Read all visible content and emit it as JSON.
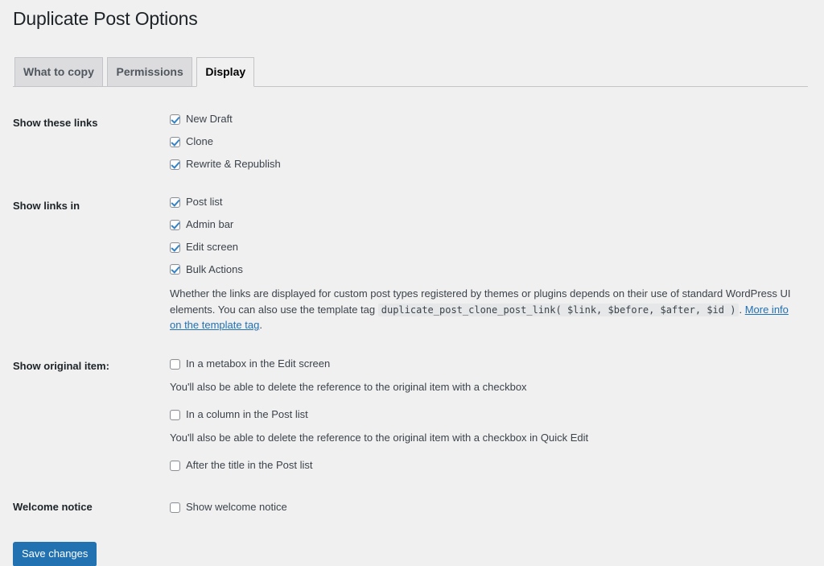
{
  "page": {
    "title": "Duplicate Post Options"
  },
  "tabs": [
    {
      "label": "What to copy",
      "active": false
    },
    {
      "label": "Permissions",
      "active": false
    },
    {
      "label": "Display",
      "active": true
    }
  ],
  "sections": {
    "show_these_links": {
      "heading": "Show these links",
      "options": [
        {
          "label": "New Draft",
          "checked": true
        },
        {
          "label": "Clone",
          "checked": true
        },
        {
          "label": "Rewrite & Republish",
          "checked": true
        }
      ]
    },
    "show_links_in": {
      "heading": "Show links in",
      "options": [
        {
          "label": "Post list",
          "checked": true
        },
        {
          "label": "Admin bar",
          "checked": true
        },
        {
          "label": "Edit screen",
          "checked": true
        },
        {
          "label": "Bulk Actions",
          "checked": true
        }
      ],
      "description_part1": "Whether the links are displayed for custom post types registered by themes or plugins depends on their use of standard WordPress UI elements. You can also use the template tag",
      "description_code": "duplicate_post_clone_post_link( $link, $before, $after, $id )",
      "description_separator": ".",
      "description_link": "More info on the template tag",
      "description_end": "."
    },
    "show_original_item": {
      "heading": "Show original item:",
      "options": [
        {
          "label": "In a metabox in the Edit screen",
          "checked": false,
          "description": "You'll also be able to delete the reference to the original item with a checkbox"
        },
        {
          "label": "In a column in the Post list",
          "checked": false,
          "description": "You'll also be able to delete the reference to the original item with a checkbox in Quick Edit"
        },
        {
          "label": "After the title in the Post list",
          "checked": false,
          "description": ""
        }
      ]
    },
    "welcome_notice": {
      "heading": "Welcome notice",
      "options": [
        {
          "label": "Show welcome notice",
          "checked": false
        }
      ]
    }
  },
  "submit": {
    "label": "Save changes"
  },
  "colors": {
    "background": "#f0f0f1",
    "primary_button": "#2271b1",
    "link": "#2271b1",
    "checkmark": "#3582c4",
    "tab_inactive": "#dcdcde",
    "heading_text": "#1d2327"
  }
}
